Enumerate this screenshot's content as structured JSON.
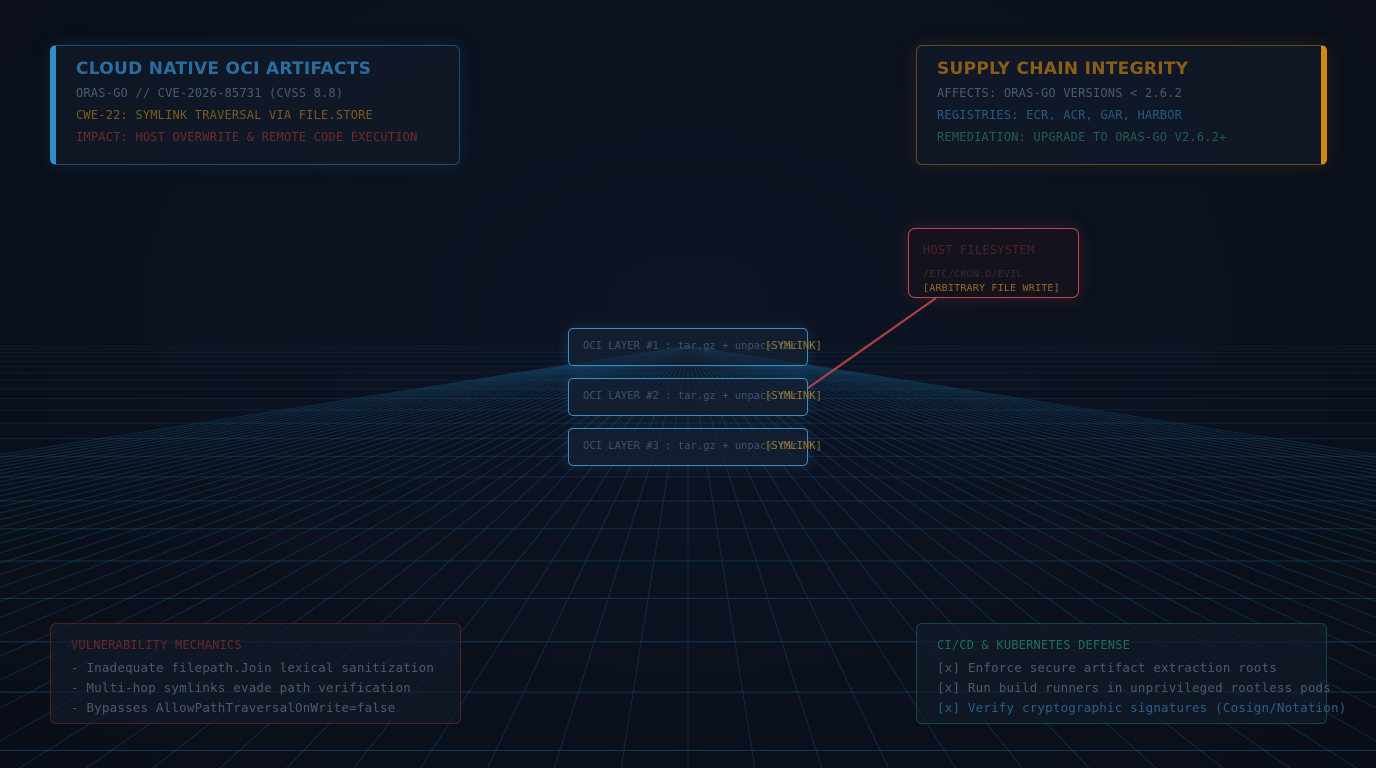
{
  "summary": {
    "title": "CLOUD NATIVE OCI ARTIFACTS",
    "cve": "ORAS-GO // CVE-2026-85731 (CVSS 8.8)",
    "cwe": "CWE-22: SYMLINK TRAVERSAL VIA FILE.STORE",
    "impact": "IMPACT: HOST OVERWRITE & REMOTE CODE EXECUTION"
  },
  "integrity": {
    "title": "SUPPLY CHAIN INTEGRITY",
    "affects": "AFFECTS: ORAS-GO VERSIONS < 2.6.2",
    "registries": "REGISTRIES: ECR, ACR, GAR, HARBOR",
    "remediation": "REMEDIATION: UPGRADE TO ORAS-GO V2.6.2+"
  },
  "host": {
    "title": "HOST FILESYSTEM",
    "path": "/ETC/CRON.D/EVIL",
    "tag": "[ARBITRARY FILE WRITE]"
  },
  "layers": [
    {
      "label": "OCI LAYER #1 : tar.gz + unpack.tar",
      "tag": "[SYMLINK]"
    },
    {
      "label": "OCI LAYER #2 : tar.gz + unpack.tar",
      "tag": "[SYMLINK]"
    },
    {
      "label": "OCI LAYER #3 : tar.gz + unpack.tar",
      "tag": "[SYMLINK]"
    }
  ],
  "mechanics": {
    "title": "VULNERABILITY MECHANICS",
    "items": [
      "- Inadequate filepath.Join lexical sanitization",
      "- Multi-hop symlinks evade path verification",
      "- Bypasses AllowPathTraversalOnWrite=false"
    ]
  },
  "defense": {
    "title": "CI/CD & KUBERNETES DEFENSE",
    "items": [
      "[x] Enforce secure artifact extraction roots",
      "[x] Run build runners in unprivileged rootless pods",
      "[x] Verify cryptographic signatures (Cosign/Notation)"
    ]
  },
  "colors": {
    "accent_blue": "#2f8fc6",
    "accent_orange": "#d08a1c",
    "accent_red": "#c0454a",
    "accent_green": "#1f8a6e",
    "grid": "#1a5a86"
  }
}
